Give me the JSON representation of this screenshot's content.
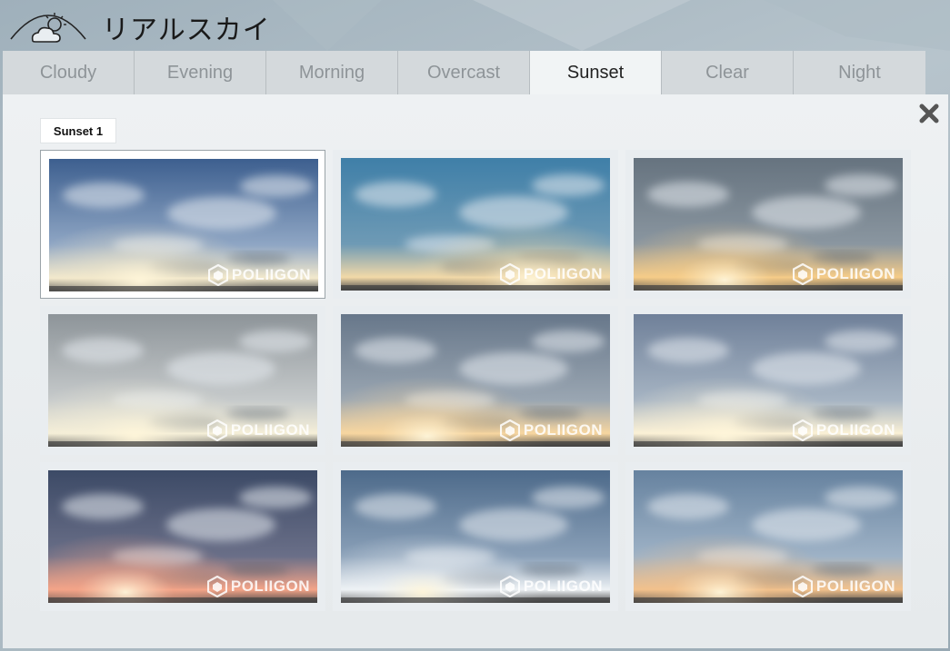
{
  "app": {
    "title": "リアルスカイ",
    "logo_icon": "cloud-sun-icon"
  },
  "tabs": [
    {
      "label": "Cloudy",
      "active": false
    },
    {
      "label": "Evening",
      "active": false
    },
    {
      "label": "Morning",
      "active": false
    },
    {
      "label": "Overcast",
      "active": false
    },
    {
      "label": "Sunset",
      "active": true
    },
    {
      "label": "Clear",
      "active": false
    },
    {
      "label": "Night",
      "active": false
    }
  ],
  "panel": {
    "close_icon": "close-icon",
    "selected_label": "Sunset 1"
  },
  "thumbnails": [
    {
      "watermark": "POLIIGON",
      "selected": true
    },
    {
      "watermark": "POLIIGON",
      "selected": false
    },
    {
      "watermark": "POLIIGON",
      "selected": false
    },
    {
      "watermark": "POLIIGON",
      "selected": false
    },
    {
      "watermark": "POLIIGON",
      "selected": false
    },
    {
      "watermark": "POLIIGON",
      "selected": false
    },
    {
      "watermark": "POLIIGON",
      "selected": false
    },
    {
      "watermark": "POLIIGON",
      "selected": false
    },
    {
      "watermark": "POLIIGON",
      "selected": false
    }
  ],
  "colors": {
    "sky_top": [
      "#3d5f8f",
      "#3f7fa8",
      "#66737f",
      "#8d9499",
      "#67778a",
      "#6f8099",
      "#3c4a66",
      "#4d6a8a",
      "#66829f"
    ],
    "sky_mid": [
      "#8fa6c4",
      "#6e9ab5",
      "#8a96a0",
      "#c6cacb",
      "#9aa6b2",
      "#a6b4c3",
      "#6a6f88",
      "#8aa0b8",
      "#9eb2c6"
    ],
    "sun_glow": [
      "#f3e9cc",
      "#f2d9a8",
      "#f6cc88",
      "#f5efd8",
      "#f7d6a0",
      "#fbf1d6",
      "#f4a488",
      "#eef2f5",
      "#f2c18c"
    ]
  }
}
